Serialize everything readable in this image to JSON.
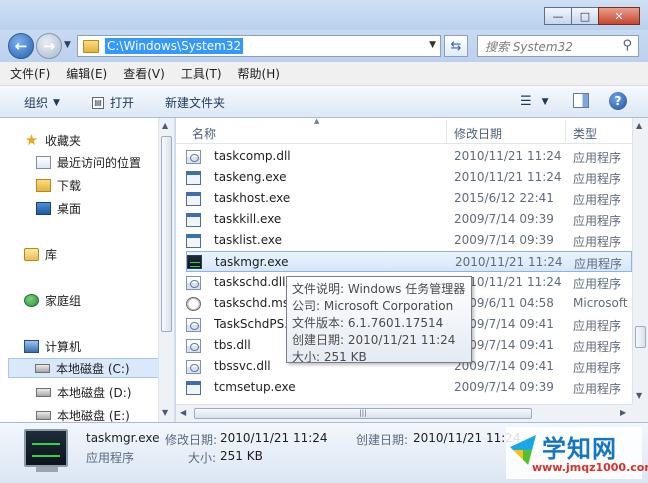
{
  "window": {
    "minimize_glyph": "—",
    "maximize_glyph": "□",
    "close_glyph": "✕"
  },
  "address": {
    "path": "C:\\Windows\\System32",
    "search_placeholder": "搜索 System32"
  },
  "menu": [
    "文件(F)",
    "编辑(E)",
    "查看(V)",
    "工具(T)",
    "帮助(H)"
  ],
  "toolbar": {
    "organize": "组织",
    "open": "打开",
    "new_folder": "新建文件夹"
  },
  "nav": {
    "favorites": "收藏夹",
    "recent": "最近访问的位置",
    "downloads": "下载",
    "desktop": "桌面",
    "libraries": "库",
    "homegroup": "家庭组",
    "computer": "计算机",
    "drive_c": "本地磁盘 (C:)",
    "drive_d": "本地磁盘 (D:)",
    "drive_e": "本地磁盘 (E:)"
  },
  "columns": {
    "name": "名称",
    "modified": "修改日期",
    "type": "类型"
  },
  "files": [
    {
      "name": "taskcomp.dll",
      "date": "2010/11/21 11:24",
      "type": "应用程序",
      "icon": "dll-icon"
    },
    {
      "name": "taskeng.exe",
      "date": "2010/11/21 11:24",
      "type": "应用程序",
      "icon": "exe-icon"
    },
    {
      "name": "taskhost.exe",
      "date": "2015/6/12 22:41",
      "type": "应用程序",
      "icon": "exe-icon"
    },
    {
      "name": "taskkill.exe",
      "date": "2009/7/14 09:39",
      "type": "应用程序",
      "icon": "exe-icon"
    },
    {
      "name": "tasklist.exe",
      "date": "2009/7/14 09:39",
      "type": "应用程序",
      "icon": "exe-icon"
    },
    {
      "name": "taskmgr.exe",
      "date": "2010/11/21 11:24",
      "type": "应用程序",
      "icon": "task-manager-icon"
    },
    {
      "name": "taskschd.dll",
      "date": "2010/11/21 11:24",
      "type": "应用程序",
      "icon": "dll-icon"
    },
    {
      "name": "taskschd.msc",
      "date": "2009/6/11 04:58",
      "type": "Microsoft",
      "icon": "clock-icon"
    },
    {
      "name": "TaskSchdPS.dll",
      "date": "2009/7/14 09:41",
      "type": "应用程序",
      "icon": "dll-icon"
    },
    {
      "name": "tbs.dll",
      "date": "2009/7/14 09:41",
      "type": "应用程序",
      "icon": "dll-icon"
    },
    {
      "name": "tbssvc.dll",
      "date": "2009/7/14 09:41",
      "type": "应用程序",
      "icon": "dll-icon"
    },
    {
      "name": "tcmsetup.exe",
      "date": "2009/7/14 09:39",
      "type": "应用程序",
      "icon": "exe-icon"
    }
  ],
  "tooltip": {
    "description": "文件说明: Windows 任务管理器",
    "company": "公司: Microsoft Corporation",
    "version": "文件版本: 6.1.7601.17514",
    "created": "创建日期: 2010/11/21 11:24",
    "size": "大小: 251 KB"
  },
  "details": {
    "file_name": "taskmgr.exe",
    "file_type": "应用程序",
    "modified_label": "修改日期:",
    "modified_value": "2010/11/21 11:24",
    "created_label": "创建日期:",
    "created_value": "2010/11/21 11:24",
    "size_label": "大小:",
    "size_value": "251 KB"
  },
  "watermark": {
    "title": "学知网",
    "url": "www.jmqz1000.com"
  }
}
